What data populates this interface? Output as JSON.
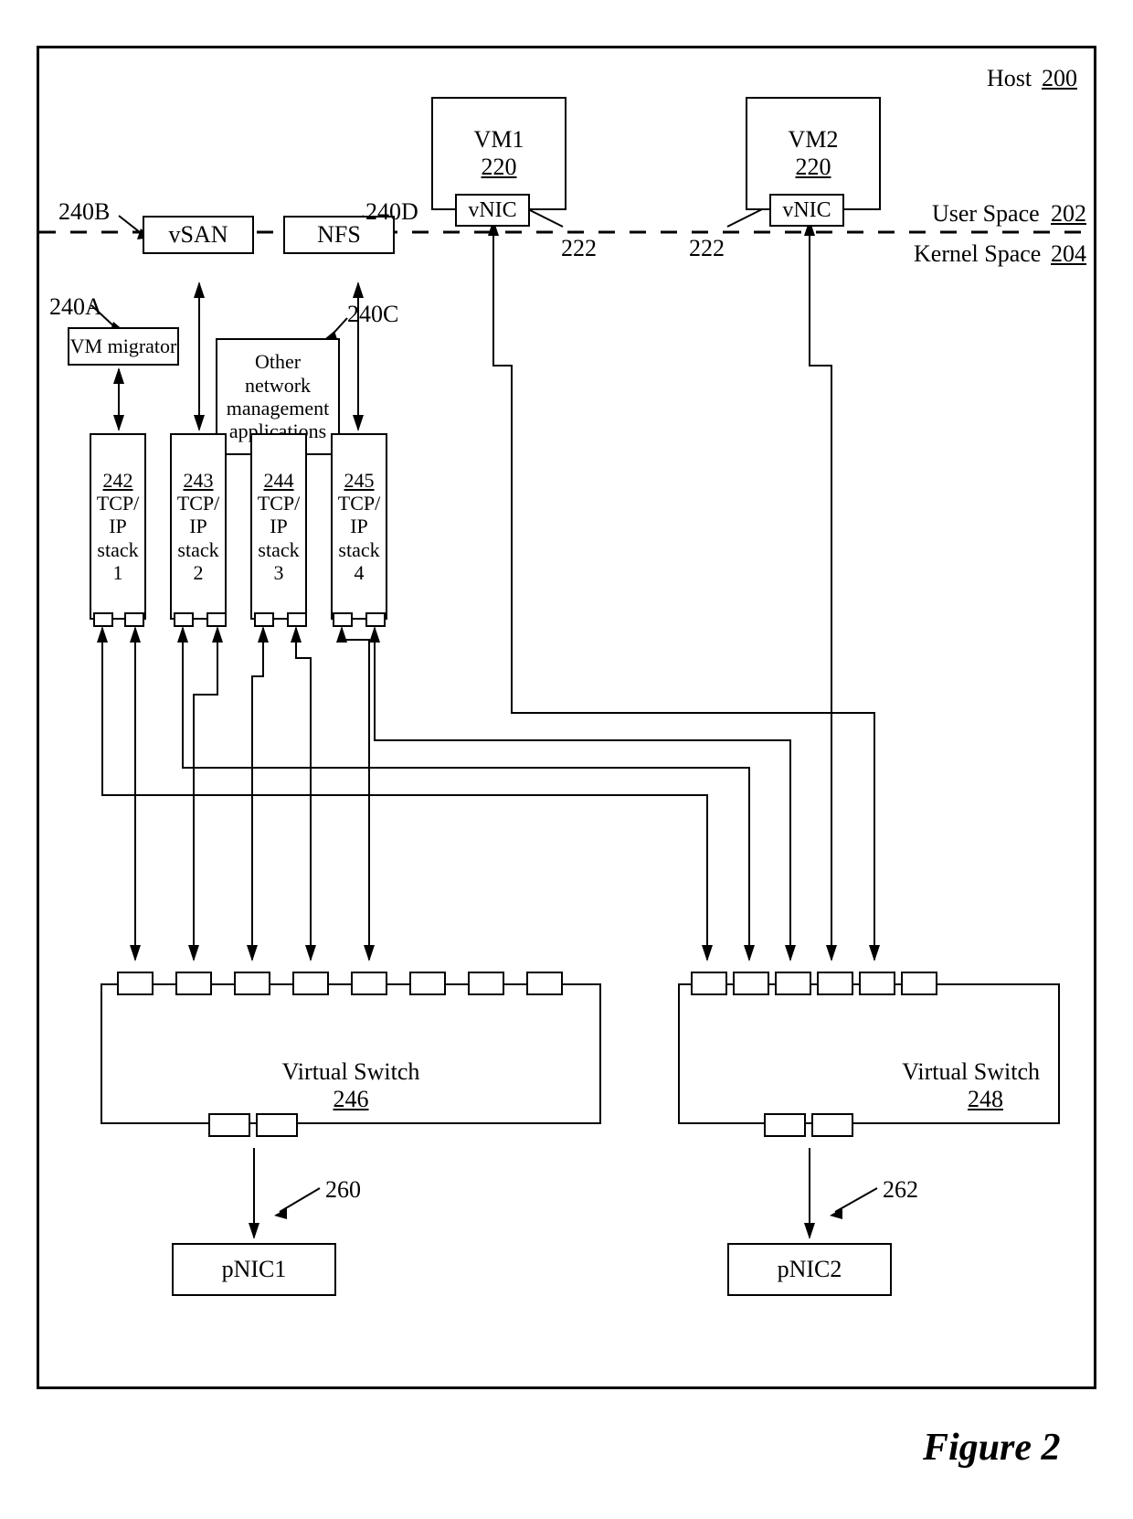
{
  "host": {
    "label": "Host",
    "num": "200"
  },
  "userSpace": {
    "label": "User Space",
    "num": "202"
  },
  "kernelSpace": {
    "label": "Kernel Space",
    "num": "204"
  },
  "vm1": {
    "label": "VM1",
    "num": "220",
    "nic": "vNIC",
    "leader": "222"
  },
  "vm2": {
    "label": "VM2",
    "num": "220",
    "nic": "vNIC",
    "leader": "222"
  },
  "apps": {
    "vm_migrator": {
      "label": "VM migrator",
      "leader": "240A"
    },
    "vsan": {
      "label": "vSAN",
      "leader": "240B"
    },
    "other": {
      "label": "Other\nnetwork\nmanagement\napplications",
      "leader": "240C"
    },
    "nfs": {
      "label": "NFS",
      "leader": "240D"
    }
  },
  "stacks": {
    "s1": {
      "num": "242",
      "label": "TCP/\nIP\nstack\n1"
    },
    "s2": {
      "num": "243",
      "label": "TCP/\nIP\nstack\n2"
    },
    "s3": {
      "num": "244",
      "label": "TCP/\nIP\nstack\n3"
    },
    "s4": {
      "num": "245",
      "label": "TCP/\nIP\nstack\n4"
    }
  },
  "vswitch1": {
    "label": "Virtual Switch",
    "num": "246"
  },
  "vswitch2": {
    "label": "Virtual Switch",
    "num": "248"
  },
  "pnic1": {
    "label": "pNIC1",
    "leader": "260"
  },
  "pnic2": {
    "label": "pNIC2",
    "leader": "262"
  },
  "figure": "Figure 2"
}
